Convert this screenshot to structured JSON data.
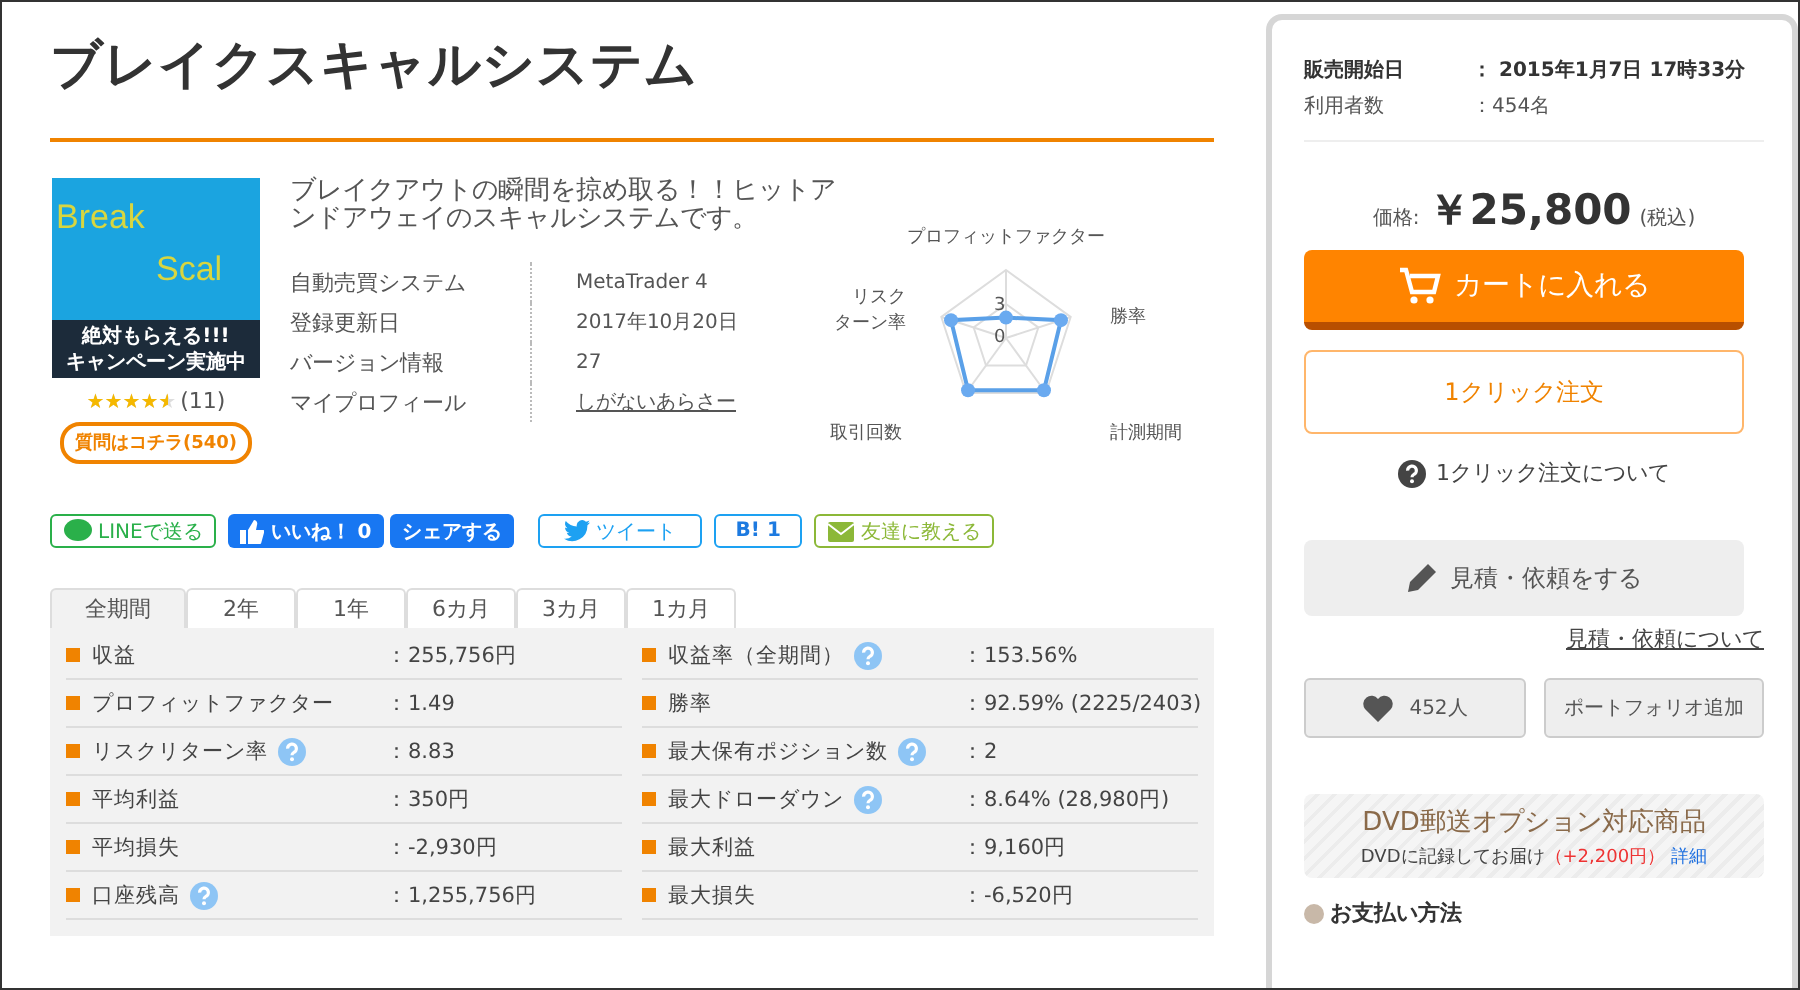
{
  "title": "ブレイクスキャルシステム",
  "thumbnail": {
    "line1": "Break",
    "line2": "Scal",
    "banner1": "絶対もらえる!!!",
    "banner2": "キャンペーン実施中"
  },
  "rating": {
    "stars": 4.5,
    "count": "(11)"
  },
  "question_button": "質問はコチラ(540)",
  "description": "ブレイクアウトの瞬間を掠め取る！！ヒットアンドアウェイのスキャルシステムです。",
  "info": [
    {
      "label": "自動売買システム",
      "value": "MetaTrader 4",
      "link": false
    },
    {
      "label": "登録更新日",
      "value": "2017年10月20日",
      "link": false
    },
    {
      "label": "バージョン情報",
      "value": "27",
      "link": false
    },
    {
      "label": "マイプロフィール",
      "value": "しがないあらさー",
      "link": true
    }
  ],
  "radar": {
    "labels": [
      {
        "lines": [
          "プロフィットファクター"
        ]
      },
      {
        "lines": [
          "勝率"
        ]
      },
      {
        "lines": [
          "計測期間"
        ]
      },
      {
        "lines": [
          "取引回数"
        ]
      },
      {
        "lines": [
          "リスク",
          "ターン率"
        ]
      }
    ],
    "ticks": [
      "3",
      "0"
    ]
  },
  "share": [
    {
      "kind": "line",
      "label": "LINEで送る"
    },
    {
      "kind": "like",
      "label": "いいね！ 0"
    },
    {
      "kind": "fbshare",
      "label": "シェアする"
    },
    {
      "kind": "tweet",
      "label": "ツイート"
    },
    {
      "kind": "hatena",
      "label": "B!  1"
    },
    {
      "kind": "mail",
      "label": "友達に教える"
    }
  ],
  "tabs": [
    {
      "label": "全期間",
      "selected": true
    },
    {
      "label": "2年",
      "selected": false
    },
    {
      "label": "1年",
      "selected": false
    },
    {
      "label": "6カ月",
      "selected": false
    },
    {
      "label": "3カ月",
      "selected": false
    },
    {
      "label": "1カ月",
      "selected": false
    }
  ],
  "stats_left": [
    {
      "label": "収益",
      "help": false,
      "value": "：255,756円"
    },
    {
      "label": "プロフィットファクター",
      "help": false,
      "value": "：1.49"
    },
    {
      "label": "リスクリターン率",
      "help": true,
      "value": "：8.83"
    },
    {
      "label": "平均利益",
      "help": false,
      "value": "：350円"
    },
    {
      "label": "平均損失",
      "help": false,
      "value": "：-2,930円"
    },
    {
      "label": "口座残高",
      "help": true,
      "value": "：1,255,756円"
    }
  ],
  "stats_right": [
    {
      "label": "収益率（全期間）",
      "help": true,
      "value": "：153.56%"
    },
    {
      "label": "勝率",
      "help": false,
      "value": "：92.59% (2225/2403)"
    },
    {
      "label": "最大保有ポジション数",
      "help": true,
      "value": "：2"
    },
    {
      "label": "最大ドローダウン",
      "help": true,
      "value": "：8.64% (28,980円)"
    },
    {
      "label": "最大利益",
      "help": false,
      "value": "：9,160円"
    },
    {
      "label": "最大損失",
      "help": false,
      "value": "：-6,520円"
    }
  ],
  "sale": [
    {
      "label": "販売開始日",
      "value": "： 2015年1月7日 17時33分",
      "bold": true
    },
    {
      "label": "利用者数",
      "value": "：454名",
      "bold": false
    }
  ],
  "price": {
    "label": "価格:",
    "amount": "￥25,800",
    "tax": "(税込)"
  },
  "cart_button": "カートに入れる",
  "one_click_button": "1クリック注文",
  "one_click_help": "1クリック注文について",
  "quote_button": "見積・依頼をする",
  "quote_link": "見積・依頼について",
  "favorite_count": "452人",
  "portfolio_button": "ポートフォリオ追加",
  "dvd": {
    "title": "DVD郵送オプション対応商品",
    "text": "DVDに記録してお届け",
    "price": "（+2,200円）",
    "link": "詳細"
  },
  "payment_heading": "お支払い方法"
}
